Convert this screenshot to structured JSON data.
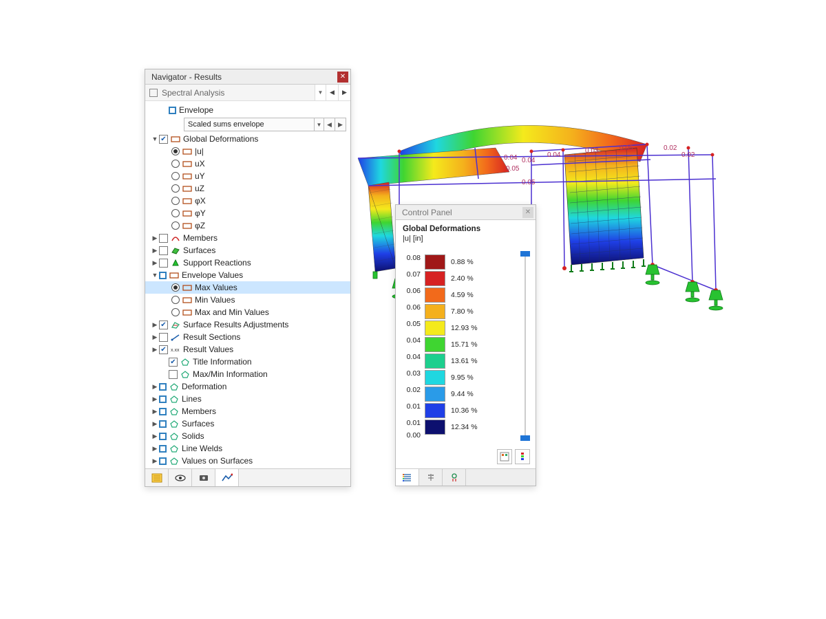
{
  "navigator": {
    "title": "Navigator - Results",
    "dropdown": "Spectral Analysis",
    "envelope": {
      "label": "Envelope",
      "select": "Scaled sums envelope"
    },
    "global_deformations": {
      "label": "Global Deformations",
      "items": [
        "|u|",
        "uX",
        "uY",
        "uZ",
        "φX",
        "φY",
        "φZ"
      ]
    },
    "sections": {
      "members": "Members",
      "surfaces": "Surfaces",
      "support_reactions": "Support Reactions"
    },
    "envelope_values": {
      "label": "Envelope Values",
      "max": "Max Values",
      "min": "Min Values",
      "maxmin": "Max and Min Values"
    },
    "more": {
      "surface_results_adjustments": "Surface Results Adjustments",
      "result_sections": "Result Sections",
      "result_values": "Result Values",
      "title_information": "Title Information",
      "maxmin_information": "Max/Min Information",
      "deformation": "Deformation",
      "lines": "Lines",
      "members2": "Members",
      "surfaces2": "Surfaces",
      "solids": "Solids",
      "line_welds": "Line Welds",
      "values_on_surfaces": "Values on Surfaces"
    }
  },
  "control_panel": {
    "title": "Control Panel",
    "heading": "Global Deformations",
    "subheading": "|u| [in]",
    "legend": [
      {
        "tick": "0.08",
        "color": "#a01818",
        "pct": "0.88 %"
      },
      {
        "tick": "0.07",
        "color": "#d62222",
        "pct": "2.40 %"
      },
      {
        "tick": "0.06",
        "color": "#f26a1b",
        "pct": "4.59 %"
      },
      {
        "tick": "0.06",
        "color": "#f4b01c",
        "pct": "7.80 %"
      },
      {
        "tick": "0.05",
        "color": "#f4ea1c",
        "pct": "12.93 %"
      },
      {
        "tick": "0.04",
        "color": "#3fd531",
        "pct": "15.71 %"
      },
      {
        "tick": "0.04",
        "color": "#1dcf8e",
        "pct": "13.61 %"
      },
      {
        "tick": "0.03",
        "color": "#1fd7e0",
        "pct": "9.95 %"
      },
      {
        "tick": "0.02",
        "color": "#2a9be8",
        "pct": "9.44 %"
      },
      {
        "tick": "0.01",
        "color": "#1f3fe6",
        "pct": "10.36 %"
      },
      {
        "tick": "0.01",
        "color": "#0d106f",
        "pct": "12.34 %"
      }
    ],
    "last_tick": "0.00"
  },
  "viewport_annotations": [
    "0.04",
    "0.05",
    "0.04",
    "0.05",
    "0.04",
    "0.03",
    "0.02",
    "0.05",
    "0.02"
  ]
}
